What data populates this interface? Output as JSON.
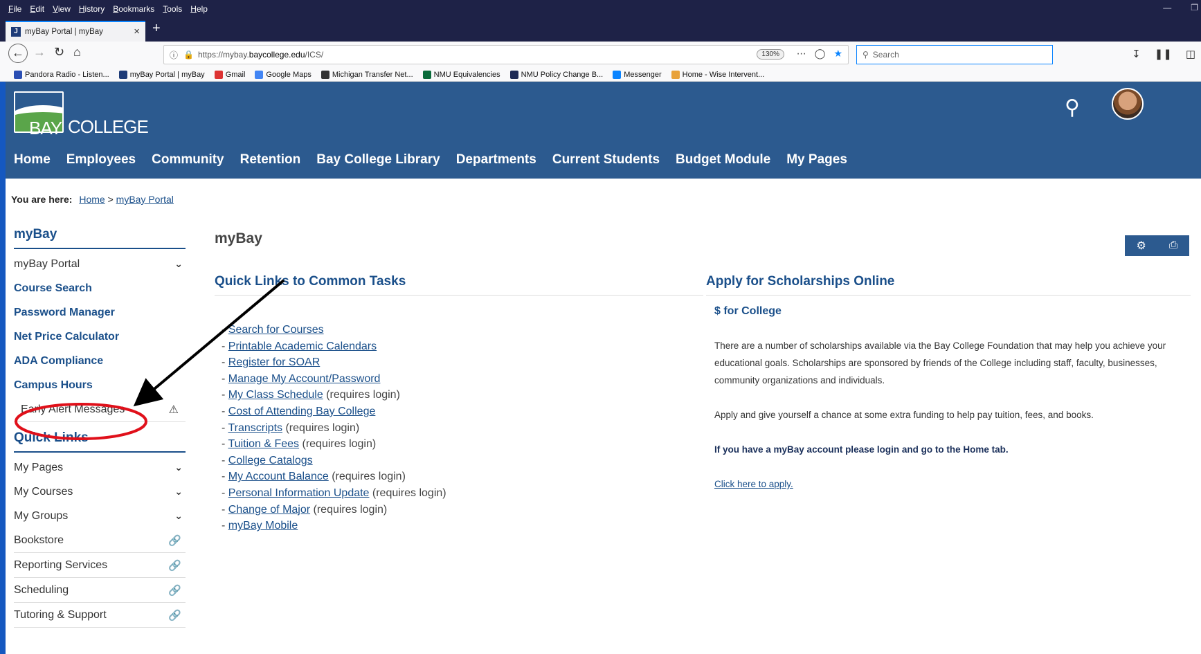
{
  "browser": {
    "menu": [
      "File",
      "Edit",
      "View",
      "History",
      "Bookmarks",
      "Tools",
      "Help"
    ],
    "tab_title": "myBay Portal | myBay",
    "url_prefix": "https://mybay.",
    "url_domain": "baycollege.edu",
    "url_path": "/ICS/",
    "zoom": "130%",
    "search_placeholder": "Search",
    "bookmarks": [
      {
        "label": "Pandora Radio - Listen...",
        "icon": "pandora-icon",
        "color": "#2b4fb3"
      },
      {
        "label": "myBay Portal | myBay",
        "icon": "mybay-icon",
        "color": "#1e3c78"
      },
      {
        "label": "Gmail",
        "icon": "gmail-icon",
        "color": "#d33"
      },
      {
        "label": "Google Maps",
        "icon": "google-icon",
        "color": "#4285f4"
      },
      {
        "label": "Michigan Transfer Net...",
        "icon": "globe-icon",
        "color": "#333"
      },
      {
        "label": "NMU Equivalencies",
        "icon": "nmu-icon",
        "color": "#0a6b3a"
      },
      {
        "label": "NMU Policy Change B...",
        "icon": "nmu-policy-icon",
        "color": "#1e2a55"
      },
      {
        "label": "Messenger",
        "icon": "messenger-icon",
        "color": "#0a84ff"
      },
      {
        "label": "Home - Wise Intervent...",
        "icon": "wise-icon",
        "color": "#e8a23a"
      }
    ]
  },
  "site": {
    "logo_bay": "BAY",
    "logo_college": "COLLEGE",
    "nav": [
      "Home",
      "Employees",
      "Community",
      "Retention",
      "Bay College Library",
      "Departments",
      "Current Students",
      "Budget Module",
      "My Pages"
    ]
  },
  "breadcrumb": {
    "label": "You are here:",
    "home": "Home",
    "separator": ">",
    "current": "myBay Portal"
  },
  "sidebar": {
    "section1_title": "myBay",
    "section1_items": [
      {
        "label": "myBay Portal",
        "style": "normal",
        "icon": "chevron-down-icon"
      },
      {
        "label": "Course Search",
        "style": "bold"
      },
      {
        "label": "Password Manager",
        "style": "bold"
      },
      {
        "label": "Net Price Calculator",
        "style": "bold"
      },
      {
        "label": "ADA Compliance",
        "style": "bold"
      },
      {
        "label": "Campus Hours",
        "style": "bold"
      },
      {
        "label": "Early Alert Messages",
        "style": "normal",
        "icon": "warning-icon"
      }
    ],
    "section2_title": "Quick Links",
    "section2_items": [
      {
        "label": "My Pages",
        "icon": "chevron-down-icon"
      },
      {
        "label": "My Courses",
        "icon": "chevron-down-icon"
      },
      {
        "label": "My Groups",
        "icon": "chevron-down-icon"
      },
      {
        "label": "Bookstore",
        "icon": "link-icon"
      },
      {
        "label": "Reporting Services",
        "icon": "link-icon"
      },
      {
        "label": "Scheduling",
        "icon": "link-icon"
      },
      {
        "label": "Tutoring & Support",
        "icon": "link-icon"
      }
    ]
  },
  "main": {
    "title": "myBay",
    "quick_links_title": "Quick Links to Common Tasks",
    "quick_links": [
      {
        "label": "Search for Courses",
        "note": ""
      },
      {
        "label": "Printable Academic Calendars",
        "note": ""
      },
      {
        "label": "Register for SOAR",
        "note": ""
      },
      {
        "label": "Manage My Account/Password",
        "note": ""
      },
      {
        "label": "My Class Schedule",
        "note": " (requires login)"
      },
      {
        "label": "Cost of Attending Bay College",
        "note": ""
      },
      {
        "label": "Transcripts",
        "note": " (requires login)"
      },
      {
        "label": "Tuition & Fees",
        "note": " (requires login)"
      },
      {
        "label": "College Catalogs",
        "note": ""
      },
      {
        "label": "My Account Balance",
        "note": " (requires login)"
      },
      {
        "label": "Personal Information Update",
        "note": " (requires login)"
      },
      {
        "label": "Change of Major",
        "note": " (requires login)"
      },
      {
        "label": "myBay Mobile",
        "note": ""
      }
    ],
    "scholarship_title": "Apply for Scholarships Online",
    "scholarship_heading": "$ for College",
    "scholarship_p1": "There are a number of scholarships available via the Bay College Foundation that may help you achieve your educational goals.  Scholarships are sponsored by friends of the College including staff, faculty, businesses, community organizations and individuals.",
    "scholarship_p2": "Apply and give yourself a chance at some extra funding to help pay tuition, fees, and books.",
    "scholarship_p3": "If you have a myBay account please login and go to the Home tab.",
    "scholarship_link": "Click here to apply."
  },
  "colors": {
    "header_blue": "#2c5a8f",
    "link_blue": "#1a4f8a",
    "annotation_red": "#e0101a"
  }
}
